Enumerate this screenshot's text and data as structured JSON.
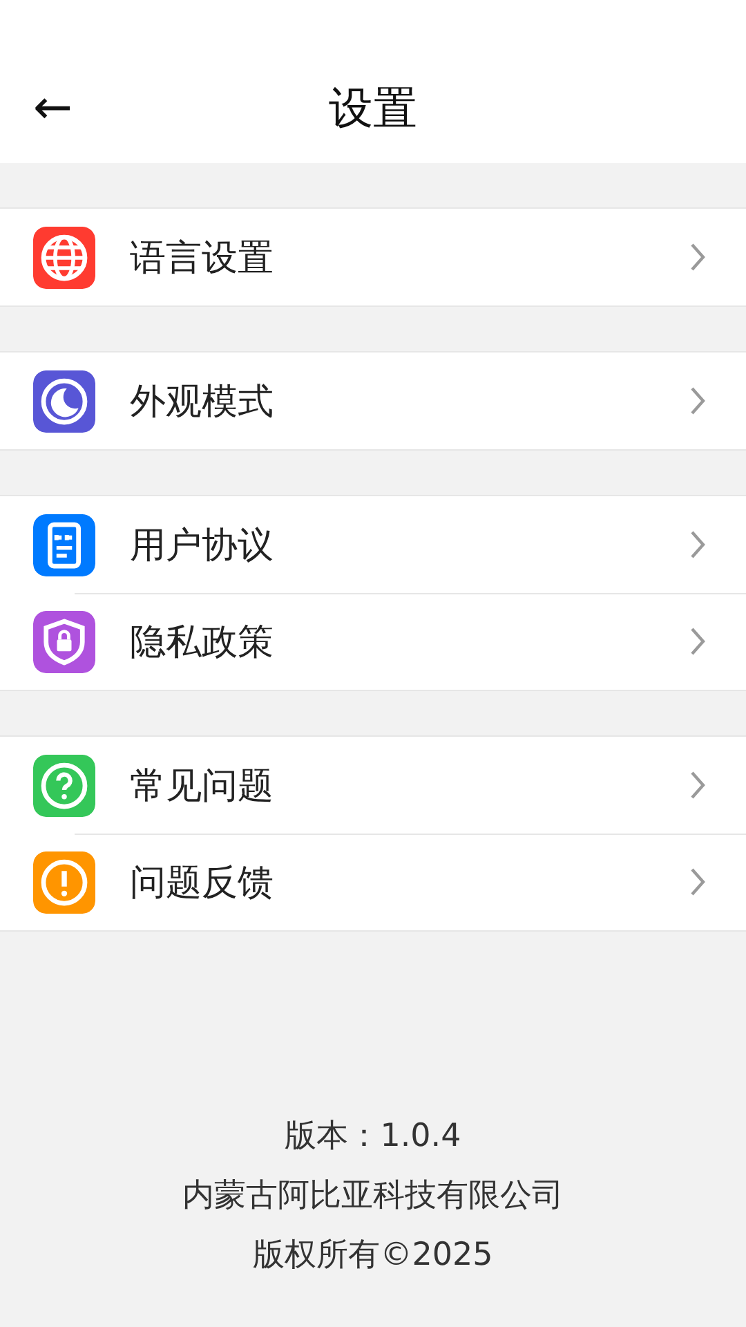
{
  "header": {
    "back": "←",
    "title": "设置"
  },
  "groups": [
    {
      "items": [
        {
          "label": "语言设置",
          "color": "#ff3b30"
        }
      ]
    },
    {
      "items": [
        {
          "label": "外观模式",
          "color": "#5856d6"
        }
      ]
    },
    {
      "items": [
        {
          "label": "用户协议",
          "color": "#007aff"
        },
        {
          "label": "隐私政策",
          "color": "#af52de"
        }
      ]
    },
    {
      "items": [
        {
          "label": "常见问题",
          "color": "#34c759"
        },
        {
          "label": "问题反馈",
          "color": "#ff9500"
        }
      ]
    }
  ],
  "footer": [
    "版本：1.0.4",
    "内蒙古阿比亚科技有限公司",
    "版权所有©2025"
  ]
}
